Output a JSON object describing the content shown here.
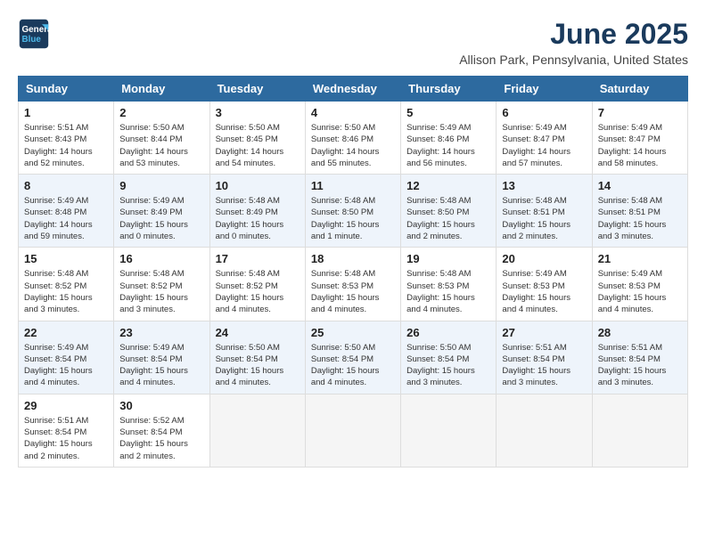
{
  "header": {
    "logo_line1": "General",
    "logo_line2": "Blue",
    "month_year": "June 2025",
    "location": "Allison Park, Pennsylvania, United States"
  },
  "weekdays": [
    "Sunday",
    "Monday",
    "Tuesday",
    "Wednesday",
    "Thursday",
    "Friday",
    "Saturday"
  ],
  "weeks": [
    [
      {
        "day": "1",
        "lines": [
          "Sunrise: 5:51 AM",
          "Sunset: 8:43 PM",
          "Daylight: 14 hours",
          "and 52 minutes."
        ]
      },
      {
        "day": "2",
        "lines": [
          "Sunrise: 5:50 AM",
          "Sunset: 8:44 PM",
          "Daylight: 14 hours",
          "and 53 minutes."
        ]
      },
      {
        "day": "3",
        "lines": [
          "Sunrise: 5:50 AM",
          "Sunset: 8:45 PM",
          "Daylight: 14 hours",
          "and 54 minutes."
        ]
      },
      {
        "day": "4",
        "lines": [
          "Sunrise: 5:50 AM",
          "Sunset: 8:46 PM",
          "Daylight: 14 hours",
          "and 55 minutes."
        ]
      },
      {
        "day": "5",
        "lines": [
          "Sunrise: 5:49 AM",
          "Sunset: 8:46 PM",
          "Daylight: 14 hours",
          "and 56 minutes."
        ]
      },
      {
        "day": "6",
        "lines": [
          "Sunrise: 5:49 AM",
          "Sunset: 8:47 PM",
          "Daylight: 14 hours",
          "and 57 minutes."
        ]
      },
      {
        "day": "7",
        "lines": [
          "Sunrise: 5:49 AM",
          "Sunset: 8:47 PM",
          "Daylight: 14 hours",
          "and 58 minutes."
        ]
      }
    ],
    [
      {
        "day": "8",
        "lines": [
          "Sunrise: 5:49 AM",
          "Sunset: 8:48 PM",
          "Daylight: 14 hours",
          "and 59 minutes."
        ]
      },
      {
        "day": "9",
        "lines": [
          "Sunrise: 5:49 AM",
          "Sunset: 8:49 PM",
          "Daylight: 15 hours",
          "and 0 minutes."
        ]
      },
      {
        "day": "10",
        "lines": [
          "Sunrise: 5:48 AM",
          "Sunset: 8:49 PM",
          "Daylight: 15 hours",
          "and 0 minutes."
        ]
      },
      {
        "day": "11",
        "lines": [
          "Sunrise: 5:48 AM",
          "Sunset: 8:50 PM",
          "Daylight: 15 hours",
          "and 1 minute."
        ]
      },
      {
        "day": "12",
        "lines": [
          "Sunrise: 5:48 AM",
          "Sunset: 8:50 PM",
          "Daylight: 15 hours",
          "and 2 minutes."
        ]
      },
      {
        "day": "13",
        "lines": [
          "Sunrise: 5:48 AM",
          "Sunset: 8:51 PM",
          "Daylight: 15 hours",
          "and 2 minutes."
        ]
      },
      {
        "day": "14",
        "lines": [
          "Sunrise: 5:48 AM",
          "Sunset: 8:51 PM",
          "Daylight: 15 hours",
          "and 3 minutes."
        ]
      }
    ],
    [
      {
        "day": "15",
        "lines": [
          "Sunrise: 5:48 AM",
          "Sunset: 8:52 PM",
          "Daylight: 15 hours",
          "and 3 minutes."
        ]
      },
      {
        "day": "16",
        "lines": [
          "Sunrise: 5:48 AM",
          "Sunset: 8:52 PM",
          "Daylight: 15 hours",
          "and 3 minutes."
        ]
      },
      {
        "day": "17",
        "lines": [
          "Sunrise: 5:48 AM",
          "Sunset: 8:52 PM",
          "Daylight: 15 hours",
          "and 4 minutes."
        ]
      },
      {
        "day": "18",
        "lines": [
          "Sunrise: 5:48 AM",
          "Sunset: 8:53 PM",
          "Daylight: 15 hours",
          "and 4 minutes."
        ]
      },
      {
        "day": "19",
        "lines": [
          "Sunrise: 5:48 AM",
          "Sunset: 8:53 PM",
          "Daylight: 15 hours",
          "and 4 minutes."
        ]
      },
      {
        "day": "20",
        "lines": [
          "Sunrise: 5:49 AM",
          "Sunset: 8:53 PM",
          "Daylight: 15 hours",
          "and 4 minutes."
        ]
      },
      {
        "day": "21",
        "lines": [
          "Sunrise: 5:49 AM",
          "Sunset: 8:53 PM",
          "Daylight: 15 hours",
          "and 4 minutes."
        ]
      }
    ],
    [
      {
        "day": "22",
        "lines": [
          "Sunrise: 5:49 AM",
          "Sunset: 8:54 PM",
          "Daylight: 15 hours",
          "and 4 minutes."
        ]
      },
      {
        "day": "23",
        "lines": [
          "Sunrise: 5:49 AM",
          "Sunset: 8:54 PM",
          "Daylight: 15 hours",
          "and 4 minutes."
        ]
      },
      {
        "day": "24",
        "lines": [
          "Sunrise: 5:50 AM",
          "Sunset: 8:54 PM",
          "Daylight: 15 hours",
          "and 4 minutes."
        ]
      },
      {
        "day": "25",
        "lines": [
          "Sunrise: 5:50 AM",
          "Sunset: 8:54 PM",
          "Daylight: 15 hours",
          "and 4 minutes."
        ]
      },
      {
        "day": "26",
        "lines": [
          "Sunrise: 5:50 AM",
          "Sunset: 8:54 PM",
          "Daylight: 15 hours",
          "and 3 minutes."
        ]
      },
      {
        "day": "27",
        "lines": [
          "Sunrise: 5:51 AM",
          "Sunset: 8:54 PM",
          "Daylight: 15 hours",
          "and 3 minutes."
        ]
      },
      {
        "day": "28",
        "lines": [
          "Sunrise: 5:51 AM",
          "Sunset: 8:54 PM",
          "Daylight: 15 hours",
          "and 3 minutes."
        ]
      }
    ],
    [
      {
        "day": "29",
        "lines": [
          "Sunrise: 5:51 AM",
          "Sunset: 8:54 PM",
          "Daylight: 15 hours",
          "and 2 minutes."
        ]
      },
      {
        "day": "30",
        "lines": [
          "Sunrise: 5:52 AM",
          "Sunset: 8:54 PM",
          "Daylight: 15 hours",
          "and 2 minutes."
        ]
      },
      {
        "day": "",
        "lines": []
      },
      {
        "day": "",
        "lines": []
      },
      {
        "day": "",
        "lines": []
      },
      {
        "day": "",
        "lines": []
      },
      {
        "day": "",
        "lines": []
      }
    ]
  ]
}
